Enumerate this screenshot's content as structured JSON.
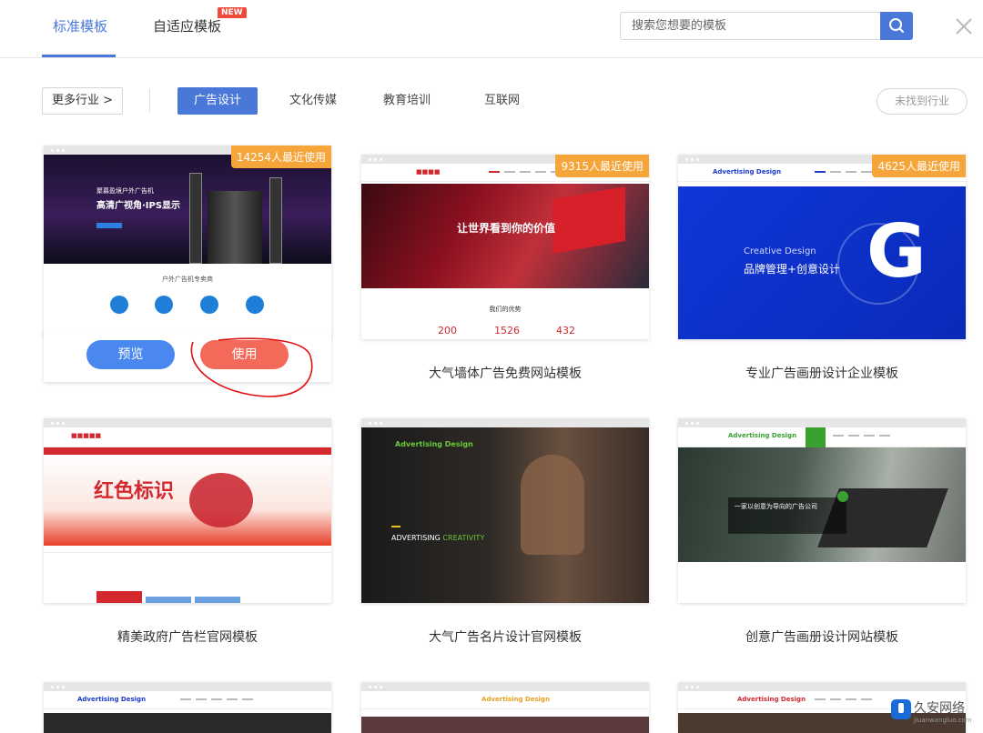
{
  "tabs": {
    "standard": "标准模板",
    "adaptive": "自适应模板",
    "new_badge": "NEW"
  },
  "search": {
    "placeholder": "搜索您想要的模板"
  },
  "filters": {
    "more": "更多行业 >",
    "industries": [
      "广告设计",
      "文化传媒",
      "教育培训",
      "互联网"
    ],
    "not_found": "未找到行业"
  },
  "cards": [
    {
      "usage": "14254人最近使用",
      "hero_line1": "聚募盈境户外广告机",
      "hero_line2": "高清广视角·IPS显示",
      "section_title": "户外广告机专卖商",
      "preview": "预览",
      "use": "使用"
    },
    {
      "usage": "9315人最近使用",
      "title": "大气墙体广告免费网站模板",
      "hero": "让世界看到你的价值",
      "section": "我们的优势",
      "stats": [
        "200",
        "1526",
        "432"
      ]
    },
    {
      "usage": "4625人最近使用",
      "title": "专业广告画册设计企业模板",
      "logo": "Advertising Design",
      "hero_en": "Creative Design",
      "hero_cn": "品牌管理+创意设计",
      "letter": "G"
    },
    {
      "title": "精美政府广告栏官网模板",
      "hero": "红色标识"
    },
    {
      "title": "大气广告名片设计官网模板",
      "logo": "Advertising Design",
      "hero_en": "ADVERTISING",
      "hero_accent": "CREATIVITY"
    },
    {
      "title": "创意广告画册设计网站模板",
      "logo": "Advertising Design",
      "hero": "一家以创意为导向的广告公司"
    },
    {
      "logo": "Advertising Design"
    },
    {
      "logo": "Advertising Design"
    },
    {
      "logo": "Advertising Design"
    }
  ],
  "watermark": {
    "name": "久安网络",
    "sub": "jiuanwangluo.com"
  },
  "colors": {
    "accent": "#4a78d8",
    "badge": "#f6a53a",
    "use": "#f46a5a",
    "preview": "#4a88f0"
  }
}
